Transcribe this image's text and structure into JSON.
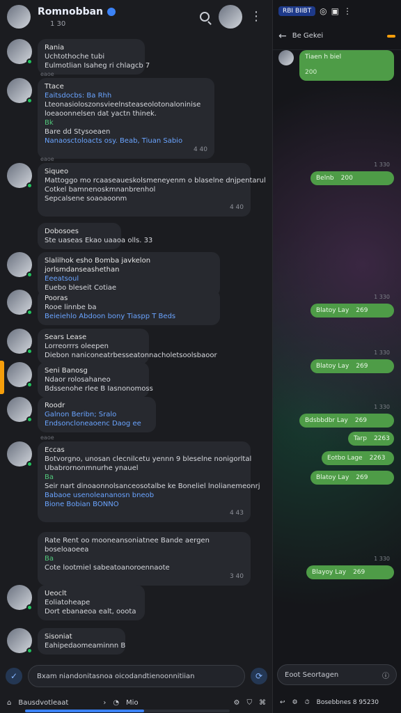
{
  "left": {
    "header": {
      "title": "Romnobban",
      "sub_badge": "",
      "sub_text": "1 30"
    },
    "chat": [
      {
        "name": "Rania",
        "tag": "",
        "lines": [
          "Uchtothoche tubi",
          "Eulmotlian Isaheg ri chlagcb 7"
        ],
        "time": ""
      },
      {
        "name": "Ttace",
        "tag": "",
        "lines": [
          "Eaitsdocbs: Ba Rhh",
          "Lteonasioloszonsvieelnsteaseolotonaloninise",
          "loeaoonnelsen dat yactn thinek.",
          "Bk",
          "Bare dd Stysoeaen",
          "Nanaosctoloacts osy. Beab, Tiuan Sabio"
        ],
        "time": "4 40"
      },
      {
        "name": "Siqueo",
        "tag": "",
        "lines": [
          "Mattoggo mo rcaaseaueskolsmeneyenm o blaselne dnjpentarul",
          "Cotkel bamnenoskmnanbrenhol",
          "Sepcalsene  soaoaoonm"
        ],
        "time": "4 40"
      },
      {
        "name": "Dobosoes",
        "tag": "",
        "lines": [
          "Ste uaseas Ekao uaaoa olls. 33"
        ],
        "time": ""
      },
      {
        "name": "Slalilhok esho Bomba javkelon jorlsmdanseashethan",
        "tag": "",
        "lines": [
          "Eeeatsoul",
          "Euebo bleseit Cotiae"
        ],
        "time": ""
      },
      {
        "name": "Pooras",
        "tag": "",
        "lines": [
          "Rooe linnbe ba",
          "Beieiehlo Abdoon bony Tiaspp T Beds"
        ],
        "time": "4 40"
      },
      {
        "name": "Sears Lease",
        "tag": "",
        "lines": [
          "Lorreorrrs oleepen",
          "Diebon naniconeatrbesseatonnacholetsoolsbaoor"
        ],
        "time": ""
      },
      {
        "name": "Seni  Banosg",
        "tag": "",
        "lines": [
          "Ndaor rolosahaneo",
          "Bdssenohe  rlee B Iasnonomoss"
        ],
        "time": ""
      },
      {
        "name": "Roodr",
        "tag": "",
        "lines": [
          "Galnon Beribn; Sralo",
          "Endsoncloneaoenc Daog ee"
        ],
        "time": ""
      },
      {
        "name": "Eccas",
        "tag": "",
        "lines": [
          "Botvorgno, unosan clecnilcetu yennn 9 bleselne nonigorltal",
          "Ubabrornonmnurhe ynauel",
          "Ba",
          "Seir nart dinoaonnolsanceosotalbe ke Boneliel lnolianemeonrj",
          "Babaoe usenoleananosn bneob",
          "Bione Bobian  BONNO"
        ],
        "time": "4 43"
      },
      {
        "name": "",
        "tag": "",
        "lines": [
          "Rate Rent oo mooneansoniatnee Bande aergen",
          "boseloaoeea",
          "Ba",
          "Cote lootmiel sabeatoanoroennaote"
        ],
        "time": "3 40"
      },
      {
        "name": "Ueoclt",
        "tag": "",
        "lines": [
          "Eoliatoheape",
          "Dort ebanaeoa ealt, ooota"
        ],
        "time": ""
      },
      {
        "name": "Sisoniat",
        "tag": "",
        "lines": [
          "Eahipedaomeaminnn B"
        ],
        "time": ""
      }
    ],
    "dividers": [
      "eaoe",
      "eaoe",
      "eaoe"
    ],
    "composer_placeholder": "Bxam niandonitasnoa oicodandtienoonnitiian",
    "bottom_label": "Bausdvotleaat",
    "bottom_tab": "Mio"
  },
  "right": {
    "brand": "RBI BIIBT",
    "title": "Be Gekei",
    "badge": "",
    "messages": [
      {
        "text": "Tiaen h biel",
        "time": "200"
      },
      {
        "text": "Belnb",
        "time": "200"
      },
      {
        "text": "Blatoy   Lay",
        "time": "269"
      },
      {
        "text": "Blatoy   Lay",
        "time": "269"
      },
      {
        "text": "Bdsbbdbr   Lay",
        "time": "269"
      },
      {
        "text": "Tarp",
        "time": "2263"
      },
      {
        "text": "Eotbo   Lage",
        "time": "2263"
      },
      {
        "text": "Blatoy   Lay",
        "time": "269"
      },
      {
        "text": "Blayoy   Lay",
        "time": "269"
      }
    ],
    "dates": [
      "1 330",
      "1 330",
      "1 330",
      "1 330",
      "1 330"
    ],
    "composer_placeholder": "Eoot Seortagen",
    "bottom_text": "Bosebbnes 8 95230"
  }
}
